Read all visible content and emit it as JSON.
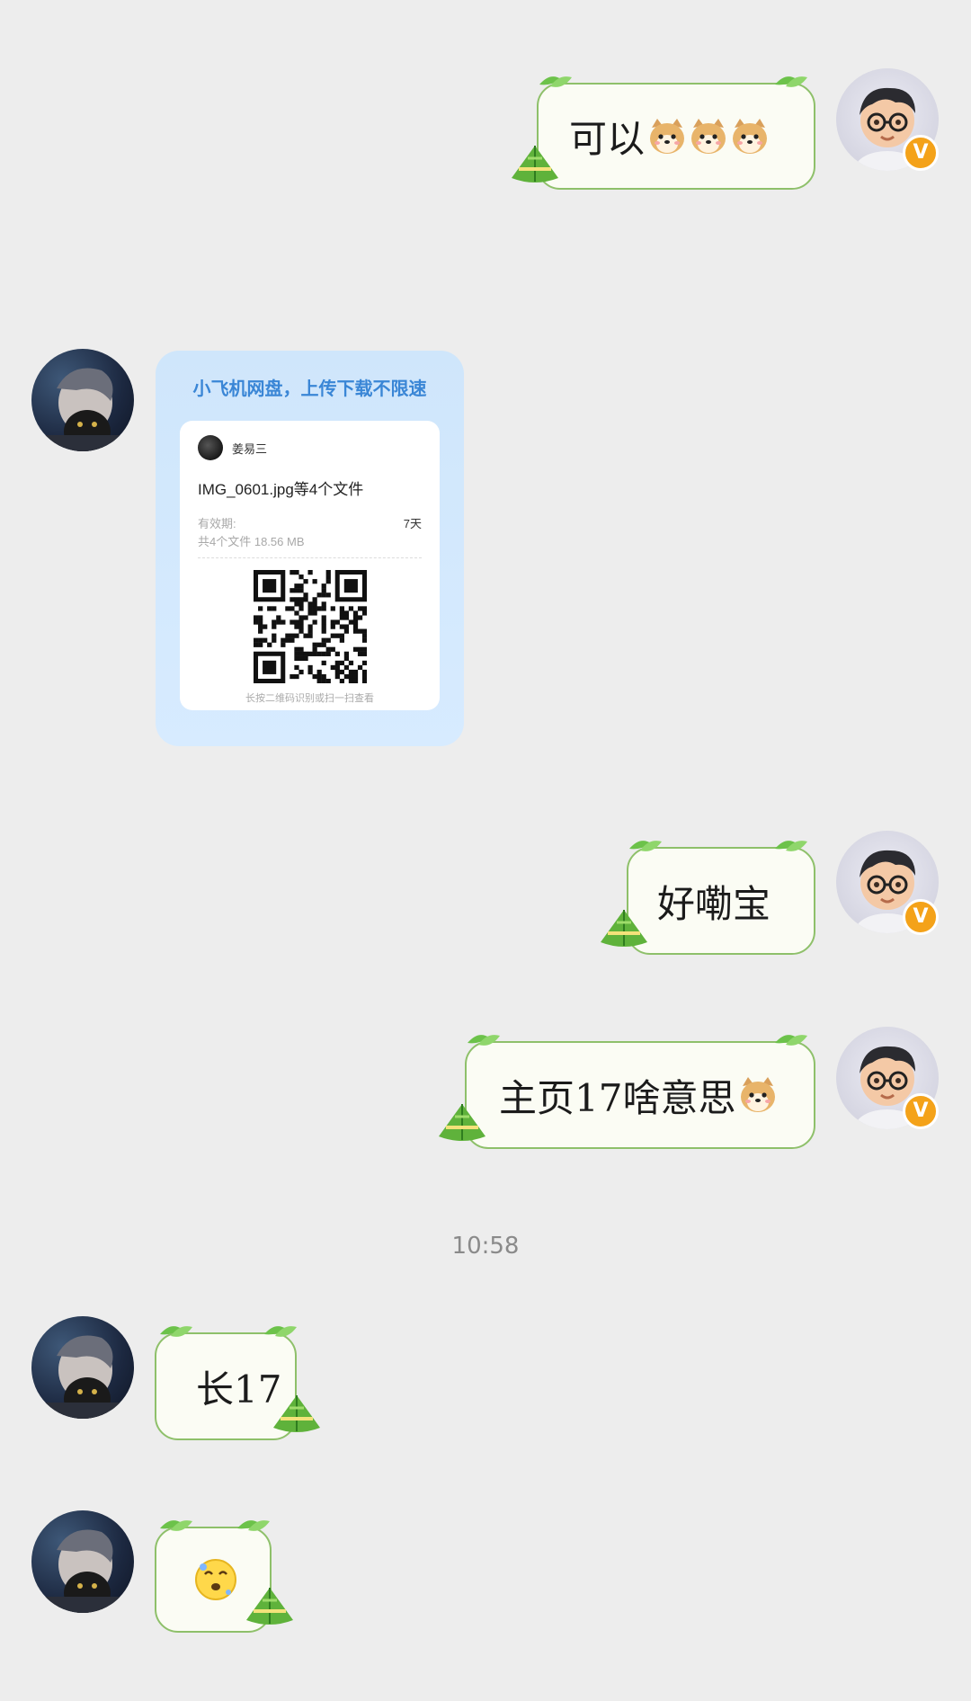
{
  "messages": [
    {
      "side": "right",
      "text": "可以",
      "emoji": [
        "shiba-emoji",
        "shiba-emoji",
        "shiba-emoji"
      ]
    },
    {
      "side": "left",
      "type": "file_card",
      "card": {
        "promo": "小飞机网盘，上传下载不限速",
        "sender": "姜易三",
        "file_name": "IMG_0601.jpg等4个文件",
        "validity_label": "有效期:",
        "validity_value": "7天",
        "summary": "共4个文件  18.56 MB",
        "qr_hint": "长按二维码识别或扫一扫查看"
      }
    },
    {
      "side": "right",
      "text": "好嘞宝"
    },
    {
      "side": "right",
      "text": "主页17啥意思",
      "emoji": [
        "shiba-emoji"
      ]
    },
    {
      "side": "left",
      "text": "长17"
    },
    {
      "side": "left",
      "type": "sticker",
      "emoji": [
        "dizzy-face-emoji"
      ]
    }
  ],
  "timestamp": "10:58",
  "colors": {
    "background": "#ededed",
    "bubble_fill": "#fbfcf4",
    "bubble_border": "#8ec06a",
    "card_blue": "#cfe6fb",
    "verified_badge": "#f4a219"
  },
  "badge": "V"
}
